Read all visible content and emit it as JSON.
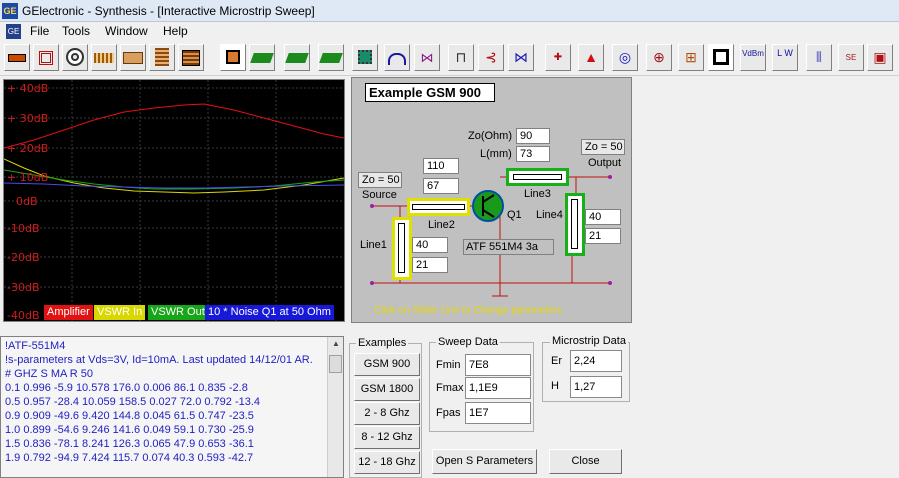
{
  "window": {
    "logo": "GE",
    "title": "GElectronic - Synthesis - [Interactive Microstrip Sweep]"
  },
  "menu": {
    "system_icon": "GE",
    "items": [
      "File",
      "Tools",
      "Window",
      "Help"
    ]
  },
  "toolbar": {
    "buttons": [
      "resistor-icon",
      "capacitor-icon",
      "spiral-inductor-icon",
      "coil-icon",
      "crystal-icon",
      "filter-block-icon",
      "transformer-icon",
      "stripline-icon",
      "coupled-line-icon",
      "chip-icon",
      "circuit-board-icon",
      "bandpass-response-icon",
      "butterworth-icon",
      "network-icon",
      "diplexer-icon",
      "matching-icon",
      "cross-icon",
      "smith-chart-icon",
      "antenna-icon",
      "target-icon",
      "crosshair-icon",
      "ladder-icon",
      "coax-icon",
      "dbm-converter-icon",
      "lw-calc-icon",
      "stub-icon",
      "s-params-icon",
      "plot-icon"
    ],
    "labels": {
      "dbm": "VdBm",
      "lw": "L W",
      "s": "SE"
    }
  },
  "graph": {
    "db_labels": [
      "+ 40dB",
      "+ 30dB",
      "+ 20dB",
      "+ 10dB",
      "0dB",
      "-10dB",
      "-20dB",
      "-30dB",
      "-40dB"
    ],
    "legend": [
      {
        "label": "Amplifier",
        "color": "#e21212"
      },
      {
        "label": "VSWR In",
        "color": "#d8d800"
      },
      {
        "label": "VSWR Out",
        "color": "#17a617"
      },
      {
        "label": "10 * Noise Q1 at 50 Ohm",
        "color": "#1818d8"
      }
    ]
  },
  "circuit": {
    "title": "Example GSM 900",
    "zo_left": "Zo = 50",
    "source": "Source",
    "zo_right": "Zo = 50",
    "output": "Output",
    "zo_label": "Zo(Ohm)",
    "l_label": "L(mm)",
    "line3_zo": "90",
    "line3_l": "73",
    "line2_zo": "110",
    "line2_l": "67",
    "line1_zo": "40",
    "line1_l": "21",
    "line4_zo": "40",
    "line4_l": "21",
    "line1": "Line1",
    "line2": "Line2",
    "line3": "Line3",
    "line4": "Line4",
    "transistor": "Q1",
    "device": "ATF 551M4 3a",
    "hint": "Click on Slider Line to Change parameters"
  },
  "sparams_text": [
    "!ATF-551M4",
    "!s-parameters at Vds=3V, Id=10mA. Last updated 14/12/01 AR.",
    "# GHZ S MA R 50",
    "0.1 0.996 -5.9 10.578 176.0 0.006 86.1 0.835 -2.8",
    "0.5 0.957 -28.4 10.059 158.5 0.027 72.0 0.792 -13.4",
    "0.9 0.909 -49.6 9.420 144.8 0.045 61.5 0.747 -23.5",
    "1.0 0.899 -54.6 9.246 141.6 0.049 59.1 0.730 -25.9",
    "1.5 0.836 -78.1 8.241 126.3 0.065 47.9 0.653 -36.1",
    "1.9 0.792 -94.9 7.424 115.7 0.074 40.3 0.593 -42.7"
  ],
  "examples": {
    "title": "Examples",
    "buttons": [
      "GSM 900",
      "GSM 1800",
      "2 - 8 Ghz",
      "8 - 12 Ghz",
      "12 - 18 Ghz"
    ]
  },
  "sweep": {
    "title": "Sweep Data",
    "fmin_label": "Fmin",
    "fmin": "7E8",
    "fmax_label": "Fmax",
    "fmax": "1,1E9",
    "fpas_label": "Fpas",
    "fpas": "1E7"
  },
  "microstrip": {
    "title": "Microstrip Data",
    "er_label": "Er",
    "er": "2,24",
    "h_label": "H",
    "h": "1,27"
  },
  "buttons": {
    "open_s": "Open S Parameters",
    "close": "Close"
  }
}
